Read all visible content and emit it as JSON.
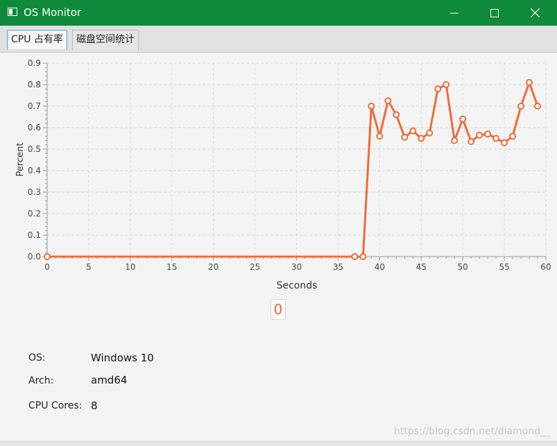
{
  "window": {
    "title": "OS Monitor"
  },
  "tabs": [
    {
      "label": "CPU 占有率"
    },
    {
      "label": "磁盘空间统计"
    }
  ],
  "value_indicator": "0",
  "info": {
    "os_label": "OS:",
    "os_value": "Windows 10",
    "arch_label": "Arch:",
    "arch_value": "amd64",
    "cores_label": "CPU Cores:",
    "cores_value": "8"
  },
  "watermark": "https://blog.csdn.net/diamond__",
  "colors": {
    "titlebar": "#0f8a3c",
    "series": "#ee6a37"
  },
  "chart_data": {
    "type": "line",
    "xlabel": "Seconds",
    "ylabel": "Percent",
    "xlim": [
      0,
      60
    ],
    "ylim": [
      0,
      0.9
    ],
    "x_ticks": [
      "0",
      "5",
      "10",
      "15",
      "20",
      "25",
      "30",
      "35",
      "40",
      "45",
      "50",
      "55",
      "60"
    ],
    "y_ticks": [
      "0.0",
      "0.1",
      "0.2",
      "0.3",
      "0.4",
      "0.5",
      "0.6",
      "0.7",
      "0.8",
      "0.9"
    ],
    "grid": true,
    "series": [
      {
        "x": [
          0,
          37,
          38,
          39,
          40,
          41,
          42,
          43,
          44,
          45,
          46,
          47,
          48,
          49,
          50,
          51,
          52,
          53,
          54,
          55,
          56,
          57,
          58,
          59
        ],
        "y": [
          0.0,
          0.0,
          0.0,
          0.7,
          0.56,
          0.725,
          0.66,
          0.555,
          0.585,
          0.55,
          0.575,
          0.78,
          0.8,
          0.54,
          0.64,
          0.535,
          0.565,
          0.57,
          0.55,
          0.53,
          0.56,
          0.7,
          0.81,
          0.7
        ]
      }
    ]
  }
}
